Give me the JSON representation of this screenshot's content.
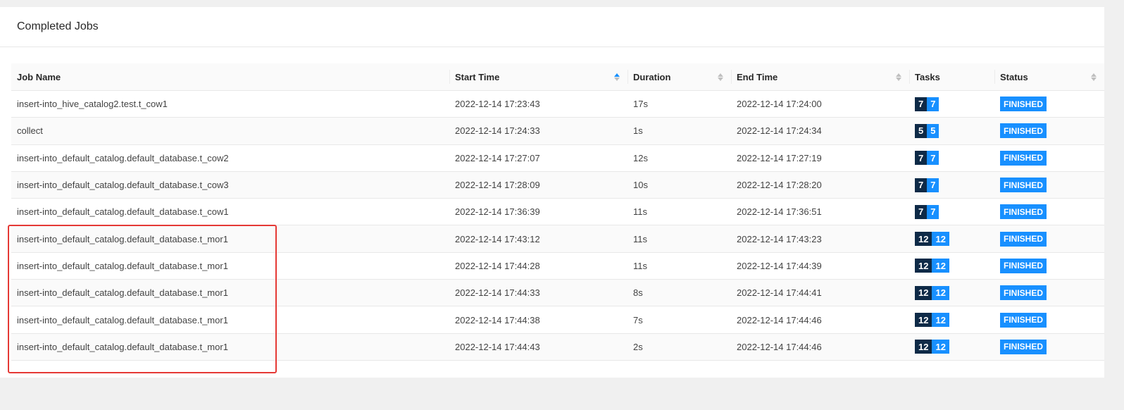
{
  "card": {
    "title": "Completed Jobs"
  },
  "columns": {
    "job_name": "Job Name",
    "start_time": "Start Time",
    "duration": "Duration",
    "end_time": "End Time",
    "tasks": "Tasks",
    "status": "Status"
  },
  "colors": {
    "accent": "#1890ff",
    "tasks_dark": "#0e2a47",
    "highlight": "#e53935"
  },
  "jobs": [
    {
      "name": "insert-into_hive_catalog2.test.t_cow1",
      "start": "2022-12-14 17:23:43",
      "duration": "17s",
      "end": "2022-12-14 17:24:00",
      "tasks_total": "7",
      "tasks_finished": "7",
      "status": "FINISHED"
    },
    {
      "name": "collect",
      "start": "2022-12-14 17:24:33",
      "duration": "1s",
      "end": "2022-12-14 17:24:34",
      "tasks_total": "5",
      "tasks_finished": "5",
      "status": "FINISHED"
    },
    {
      "name": "insert-into_default_catalog.default_database.t_cow2",
      "start": "2022-12-14 17:27:07",
      "duration": "12s",
      "end": "2022-12-14 17:27:19",
      "tasks_total": "7",
      "tasks_finished": "7",
      "status": "FINISHED"
    },
    {
      "name": "insert-into_default_catalog.default_database.t_cow3",
      "start": "2022-12-14 17:28:09",
      "duration": "10s",
      "end": "2022-12-14 17:28:20",
      "tasks_total": "7",
      "tasks_finished": "7",
      "status": "FINISHED"
    },
    {
      "name": "insert-into_default_catalog.default_database.t_cow1",
      "start": "2022-12-14 17:36:39",
      "duration": "11s",
      "end": "2022-12-14 17:36:51",
      "tasks_total": "7",
      "tasks_finished": "7",
      "status": "FINISHED"
    },
    {
      "name": "insert-into_default_catalog.default_database.t_mor1",
      "start": "2022-12-14 17:43:12",
      "duration": "11s",
      "end": "2022-12-14 17:43:23",
      "tasks_total": "12",
      "tasks_finished": "12",
      "status": "FINISHED"
    },
    {
      "name": "insert-into_default_catalog.default_database.t_mor1",
      "start": "2022-12-14 17:44:28",
      "duration": "11s",
      "end": "2022-12-14 17:44:39",
      "tasks_total": "12",
      "tasks_finished": "12",
      "status": "FINISHED"
    },
    {
      "name": "insert-into_default_catalog.default_database.t_mor1",
      "start": "2022-12-14 17:44:33",
      "duration": "8s",
      "end": "2022-12-14 17:44:41",
      "tasks_total": "12",
      "tasks_finished": "12",
      "status": "FINISHED"
    },
    {
      "name": "insert-into_default_catalog.default_database.t_mor1",
      "start": "2022-12-14 17:44:38",
      "duration": "7s",
      "end": "2022-12-14 17:44:46",
      "tasks_total": "12",
      "tasks_finished": "12",
      "status": "FINISHED"
    },
    {
      "name": "insert-into_default_catalog.default_database.t_mor1",
      "start": "2022-12-14 17:44:43",
      "duration": "2s",
      "end": "2022-12-14 17:44:46",
      "tasks_total": "12",
      "tasks_finished": "12",
      "status": "FINISHED"
    }
  ]
}
